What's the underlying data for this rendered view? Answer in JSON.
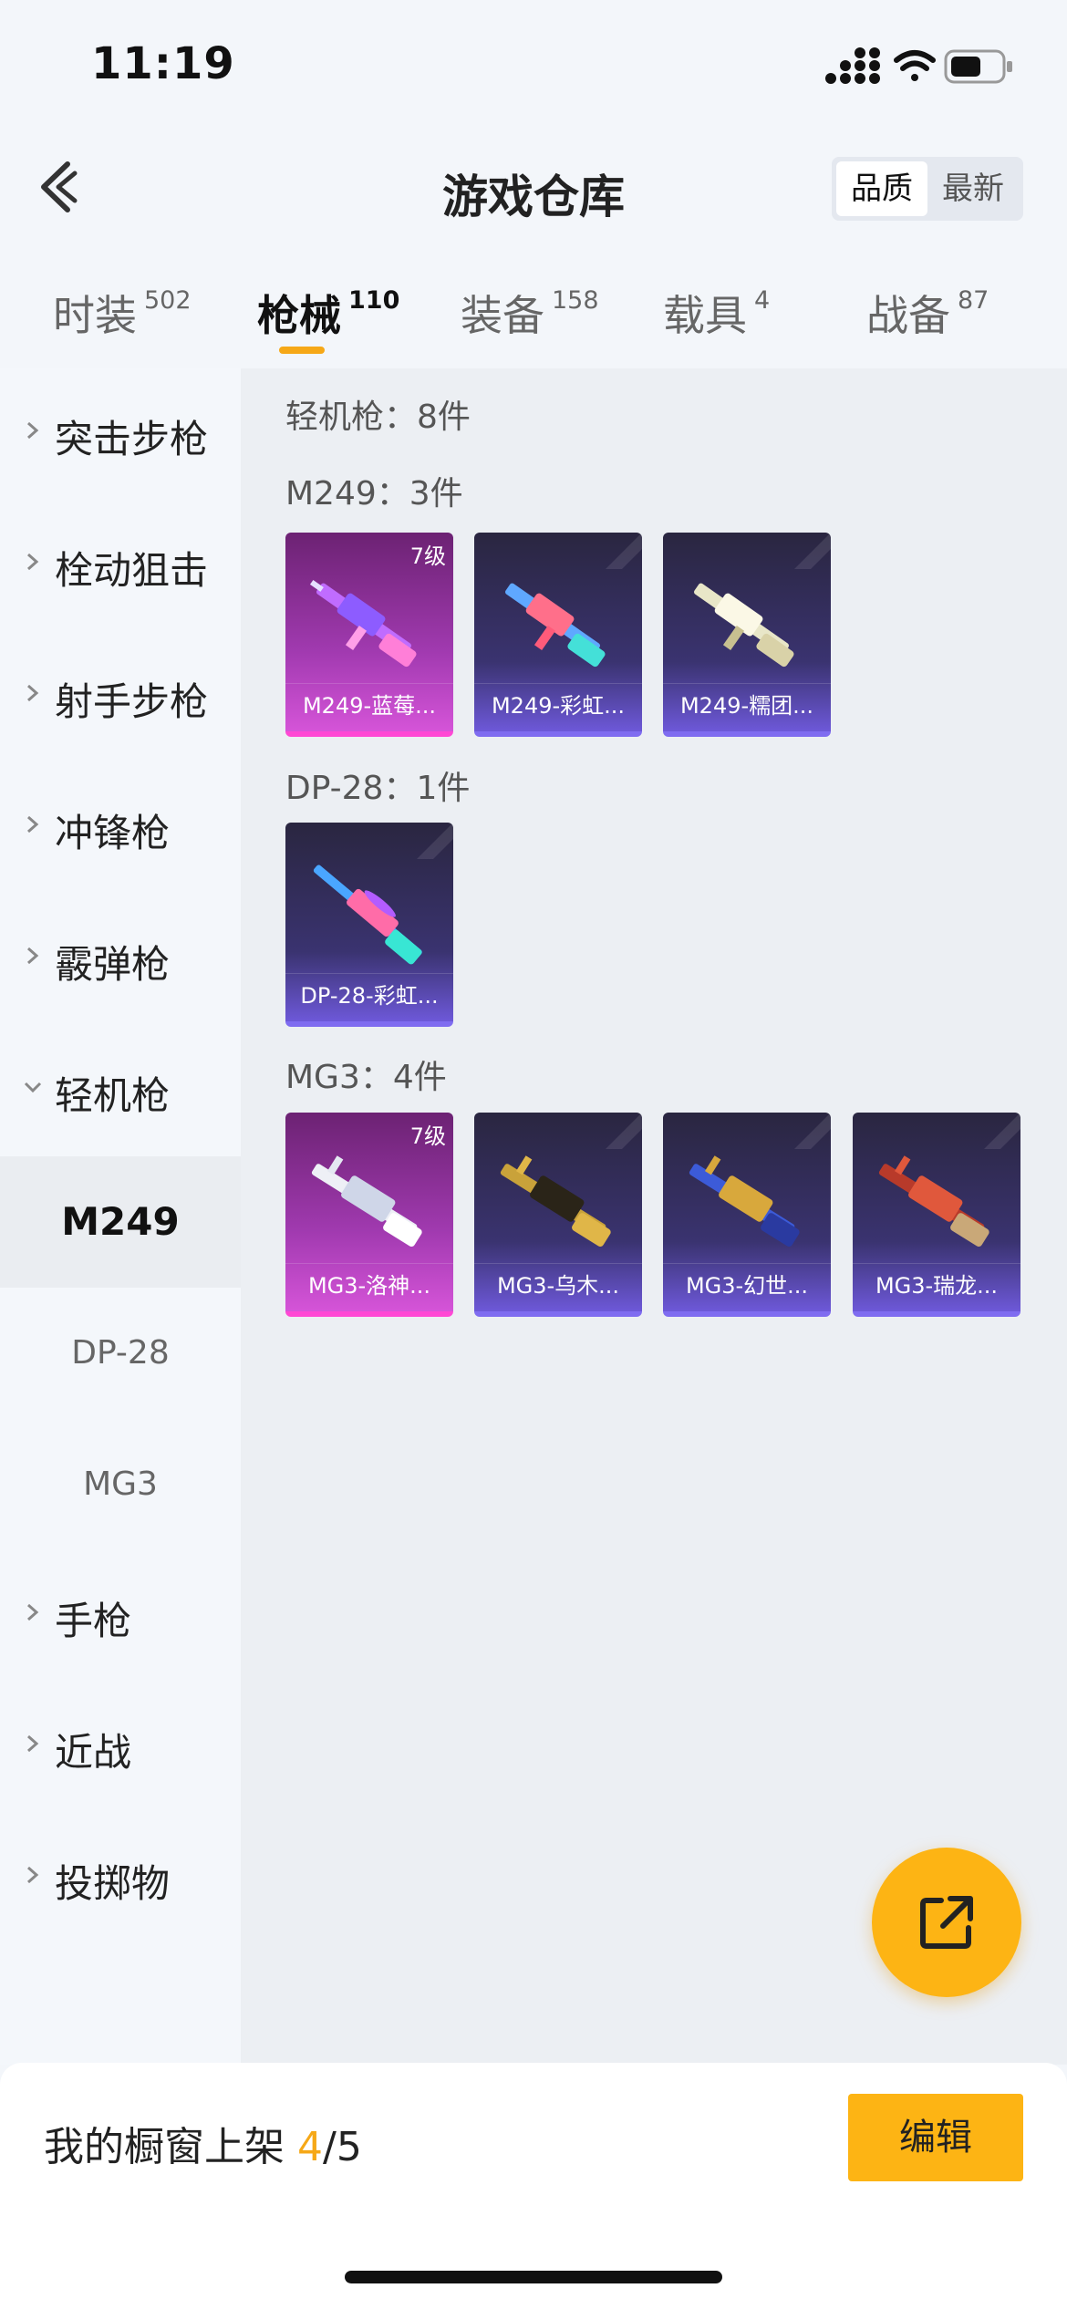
{
  "status_bar": {
    "time": "11:19"
  },
  "header": {
    "title": "游戏仓库"
  },
  "sort": {
    "quality": "品质",
    "newest": "最新",
    "selected": "quality"
  },
  "tabs": [
    {
      "label": "时装",
      "count": "502"
    },
    {
      "label": "枪械",
      "count": "110",
      "active": true
    },
    {
      "label": "装备",
      "count": "158"
    },
    {
      "label": "载具",
      "count": "4"
    },
    {
      "label": "战备",
      "count": "87"
    }
  ],
  "sidebar": {
    "items": [
      {
        "label": "突击步枪"
      },
      {
        "label": "栓动狙击"
      },
      {
        "label": "射手步枪"
      },
      {
        "label": "冲锋枪"
      },
      {
        "label": "霰弹枪"
      },
      {
        "label": "轻机枪",
        "expanded": true
      }
    ],
    "subitems": [
      {
        "label": "M249",
        "active": true
      },
      {
        "label": "DP-28"
      },
      {
        "label": "MG3"
      }
    ],
    "items_after": [
      {
        "label": "手枪"
      },
      {
        "label": "近战"
      },
      {
        "label": "投掷物"
      }
    ]
  },
  "content": {
    "category_header": "轻机枪：8件",
    "sections": [
      {
        "header": "M249：3件",
        "items": [
          {
            "name": "M249-蓝莓...",
            "level": "7级",
            "rarity": "pink"
          },
          {
            "name": "M249-彩虹...",
            "rarity": "purple"
          },
          {
            "name": "M249-糯团...",
            "rarity": "purple"
          }
        ]
      },
      {
        "header": "DP-28：1件",
        "items": [
          {
            "name": "DP-28-彩虹...",
            "rarity": "purple"
          }
        ]
      },
      {
        "header": "MG3：4件",
        "items": [
          {
            "name": "MG3-洛神...",
            "level": "7级",
            "rarity": "pink"
          },
          {
            "name": "MG3-乌木...",
            "rarity": "purple"
          },
          {
            "name": "MG3-幻世...",
            "rarity": "purple"
          },
          {
            "name": "MG3-瑞龙...",
            "rarity": "purple"
          }
        ]
      }
    ]
  },
  "bottom_bar": {
    "label": "我的橱窗上架",
    "count": "4",
    "total": "/5",
    "edit": "编辑"
  },
  "colors": {
    "accent": "#fdb414",
    "pink_rarity": "#d554d8",
    "purple_rarity": "#6d58d8"
  },
  "icons": {
    "back": "chevron-left-icon",
    "fab": "share-external-icon"
  }
}
